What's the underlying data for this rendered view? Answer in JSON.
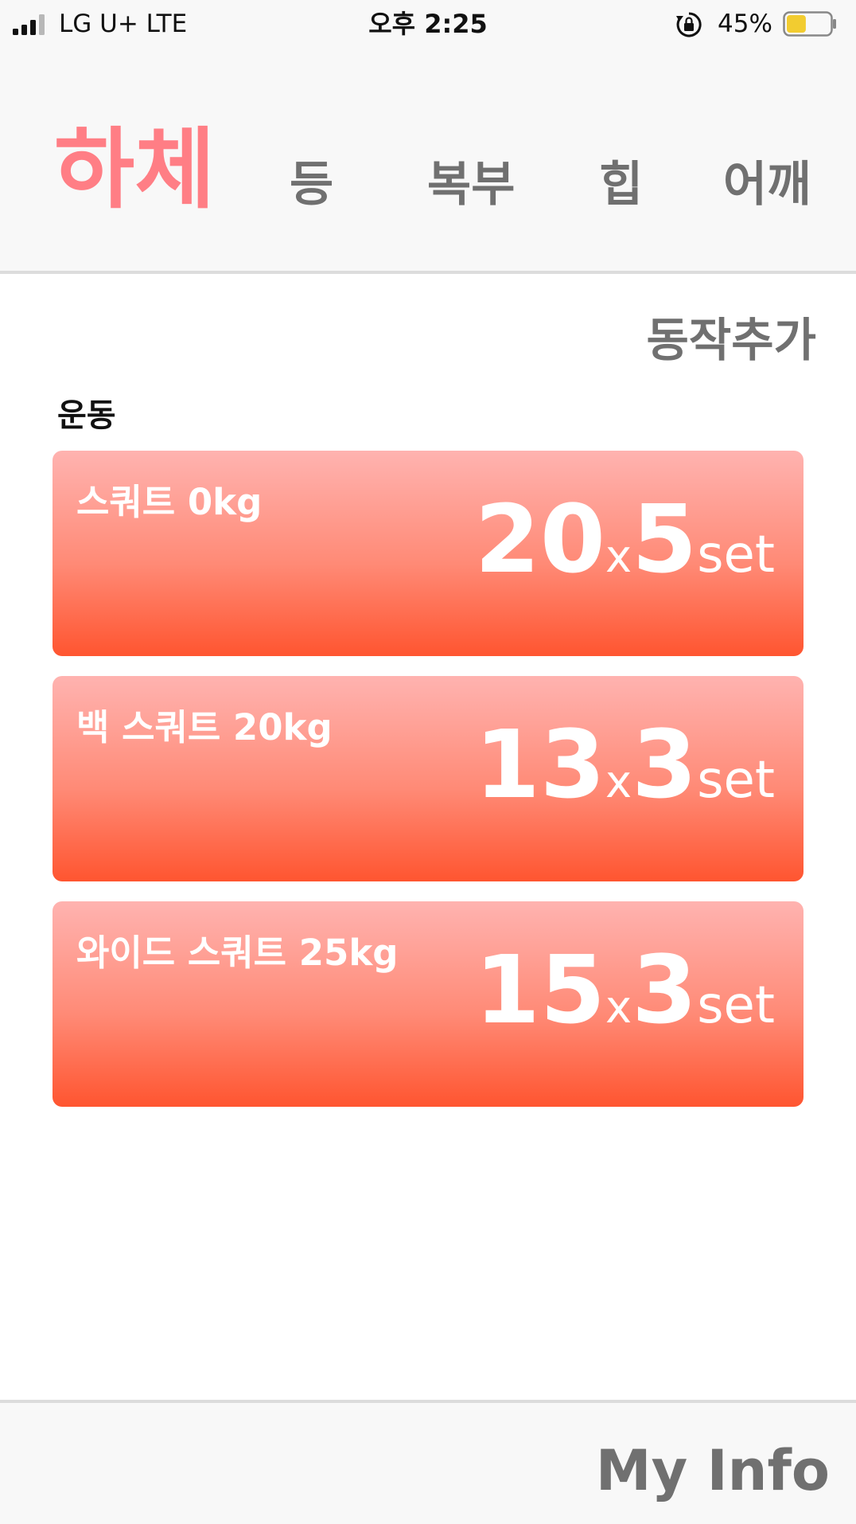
{
  "status_bar": {
    "carrier": "LG U+   LTE",
    "time": "오후 2:25",
    "battery_percent": "45%",
    "signal_bars_filled": 3,
    "signal_bars_total": 4,
    "battery_level": 0.45,
    "battery_color": "#f2cc30",
    "icons": [
      "signal-icon",
      "rotation-lock-icon",
      "battery-icon"
    ]
  },
  "tabs": [
    {
      "label": "하체",
      "active": true
    },
    {
      "label": "등",
      "active": false
    },
    {
      "label": "복부",
      "active": false
    },
    {
      "label": "힙",
      "active": false
    },
    {
      "label": "어깨",
      "active": false
    }
  ],
  "main": {
    "add_label": "동작추가",
    "section_label": "운동",
    "exercises": [
      {
        "name": "스쿼트 0kg",
        "reps": "20",
        "x": "x",
        "sets": "5",
        "set_label": "set"
      },
      {
        "name": "백 스쿼트 20kg",
        "reps": "13",
        "x": "x",
        "sets": "3",
        "set_label": "set"
      },
      {
        "name": "와이드 스쿼트 25kg",
        "reps": "15",
        "x": "x",
        "sets": "3",
        "set_label": "set"
      }
    ]
  },
  "footer": {
    "my_info_label": "My Info"
  },
  "colors": {
    "accent": "#ff7e85",
    "card_gradient_top": "#ffb3b0",
    "card_gradient_bottom": "#ff5530",
    "inactive_text": "#707070"
  }
}
